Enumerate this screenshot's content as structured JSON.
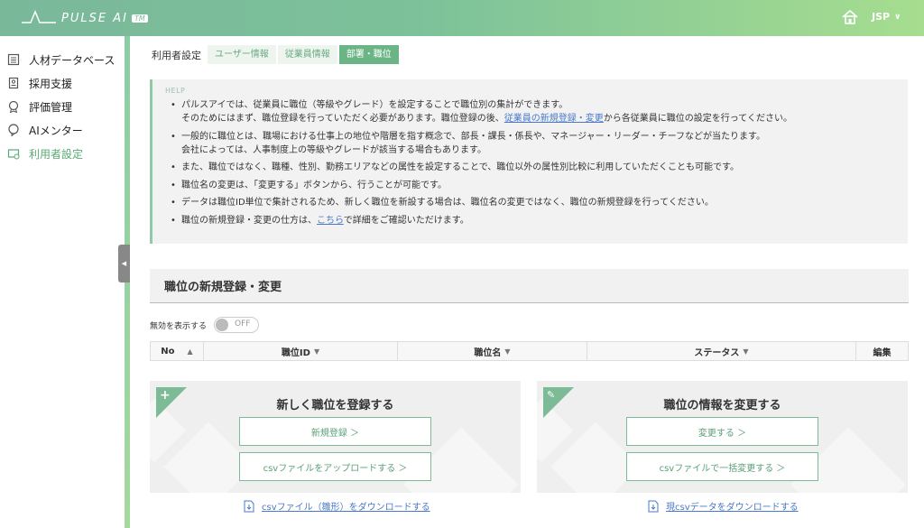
{
  "header": {
    "logo_text": "PULSE AI",
    "logo_tm": "TM",
    "user": "JSP"
  },
  "sidebar": {
    "items": [
      {
        "label": "人材データベース",
        "icon": "database-icon"
      },
      {
        "label": "採用支援",
        "icon": "recruit-icon"
      },
      {
        "label": "評価管理",
        "icon": "evaluation-icon"
      },
      {
        "label": "AIメンター",
        "icon": "mentor-icon"
      },
      {
        "label": "利用者設定",
        "icon": "user-settings-icon",
        "active": true
      }
    ]
  },
  "breadcrumb": {
    "title": "利用者設定",
    "tabs": [
      {
        "label": "ユーザー情報"
      },
      {
        "label": "従業員情報"
      },
      {
        "label": "部署・職位",
        "active": true
      }
    ]
  },
  "help": {
    "label": "HELP",
    "items": [
      {
        "line1": "パルスアイでは、従業員に職位（等級やグレード）を設定することで職位別の集計ができます。",
        "line2_pre": "そのためにはまず、職位登録を行っていただく必要があります。職位登録の後、",
        "line2_link": "従業員の新規登録・変更",
        "line2_post": "から各従業員に職位の設定を行ってください。"
      },
      {
        "line1": "一般的に職位とは、職場における仕事上の地位や階層を指す概念で、部長・課長・係長や、マネージャー・リーダー・チーフなどが当たります。",
        "line2": "会社によっては、人事制度上の等級やグレードが該当する場合もあります。"
      },
      {
        "line1": "また、職位ではなく、職種、性別、勤務エリアなどの属性を設定することで、職位以外の属性別比較に利用していただくことも可能です。"
      },
      {
        "line1": "職位名の変更は、「変更する」ボタンから、行うことが可能です。"
      },
      {
        "line1": "データは職位ID単位で集計されるため、新しく職位を新設する場合は、職位名の変更ではなく、職位の新規登録を行ってください。"
      },
      {
        "pre": "職位の新規登録・変更の仕方は、",
        "link": "こちら",
        "post": "で詳細をご確認いただけます。"
      }
    ]
  },
  "section": {
    "title": "職位の新規登録・変更"
  },
  "toggle": {
    "label": "無効を表示する",
    "state": "OFF"
  },
  "table": {
    "columns": [
      "No",
      "職位ID",
      "職位名",
      "ステータス",
      "編集"
    ]
  },
  "cards": {
    "register": {
      "title": "新しく職位を登録する",
      "btn1": "新規登録 ＞",
      "btn2": "csvファイルをアップロードする ＞",
      "download": "csvファイル（雛形）をダウンロードする"
    },
    "change": {
      "title": "職位の情報を変更する",
      "btn1": "変更する ＞",
      "btn2": "csvファイルで一括変更する ＞",
      "download": "現csvデータをダウンロードする"
    }
  }
}
